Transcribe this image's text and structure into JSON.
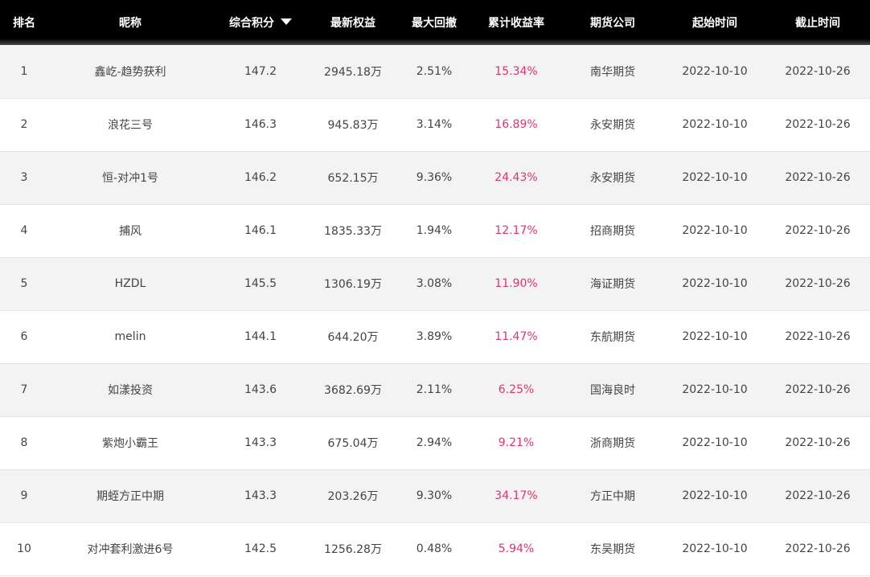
{
  "headers": {
    "rank": "排名",
    "nickname": "昵称",
    "score": "综合积分",
    "equity": "最新权益",
    "drawdown": "最大回撤",
    "return_rate": "累计收益率",
    "company": "期货公司",
    "start": "起始时间",
    "end": "截止时间"
  },
  "sort": {
    "column": "score",
    "direction": "desc",
    "icon": "sort-desc-triangle-icon"
  },
  "colors": {
    "header_bg": "#000000",
    "header_text": "#ffffff",
    "rate_text": "#e5336d",
    "body_text": "#444444",
    "stripe": "#f3f3f3"
  },
  "rows": [
    {
      "rank": "1",
      "nickname": "鑫屹-趋势获利",
      "score": "147.2",
      "equity": "2945.18万",
      "drawdown": "2.51%",
      "return_rate": "15.34%",
      "company": "南华期货",
      "start": "2022-10-10",
      "end": "2022-10-26"
    },
    {
      "rank": "2",
      "nickname": "浪花三号",
      "score": "146.3",
      "equity": "945.83万",
      "drawdown": "3.14%",
      "return_rate": "16.89%",
      "company": "永安期货",
      "start": "2022-10-10",
      "end": "2022-10-26"
    },
    {
      "rank": "3",
      "nickname": "恒-对冲1号",
      "score": "146.2",
      "equity": "652.15万",
      "drawdown": "9.36%",
      "return_rate": "24.43%",
      "company": "永安期货",
      "start": "2022-10-10",
      "end": "2022-10-26"
    },
    {
      "rank": "4",
      "nickname": "捕风",
      "score": "146.1",
      "equity": "1835.33万",
      "drawdown": "1.94%",
      "return_rate": "12.17%",
      "company": "招商期货",
      "start": "2022-10-10",
      "end": "2022-10-26"
    },
    {
      "rank": "5",
      "nickname": "HZDL",
      "score": "145.5",
      "equity": "1306.19万",
      "drawdown": "3.08%",
      "return_rate": "11.90%",
      "company": "海证期货",
      "start": "2022-10-10",
      "end": "2022-10-26"
    },
    {
      "rank": "6",
      "nickname": "melin",
      "score": "144.1",
      "equity": "644.20万",
      "drawdown": "3.89%",
      "return_rate": "11.47%",
      "company": "东航期货",
      "start": "2022-10-10",
      "end": "2022-10-26"
    },
    {
      "rank": "7",
      "nickname": "如漾投资",
      "score": "143.6",
      "equity": "3682.69万",
      "drawdown": "2.11%",
      "return_rate": "6.25%",
      "company": "国海良时",
      "start": "2022-10-10",
      "end": "2022-10-26"
    },
    {
      "rank": "8",
      "nickname": "紫炮小霸王",
      "score": "143.3",
      "equity": "675.04万",
      "drawdown": "2.94%",
      "return_rate": "9.21%",
      "company": "浙商期货",
      "start": "2022-10-10",
      "end": "2022-10-26"
    },
    {
      "rank": "9",
      "nickname": "期蛭方正中期",
      "score": "143.3",
      "equity": "203.26万",
      "drawdown": "9.30%",
      "return_rate": "34.17%",
      "company": "方正中期",
      "start": "2022-10-10",
      "end": "2022-10-26"
    },
    {
      "rank": "10",
      "nickname": "对冲套利激进6号",
      "score": "142.5",
      "equity": "1256.28万",
      "drawdown": "0.48%",
      "return_rate": "5.94%",
      "company": "东吴期货",
      "start": "2022-10-10",
      "end": "2022-10-26"
    }
  ]
}
